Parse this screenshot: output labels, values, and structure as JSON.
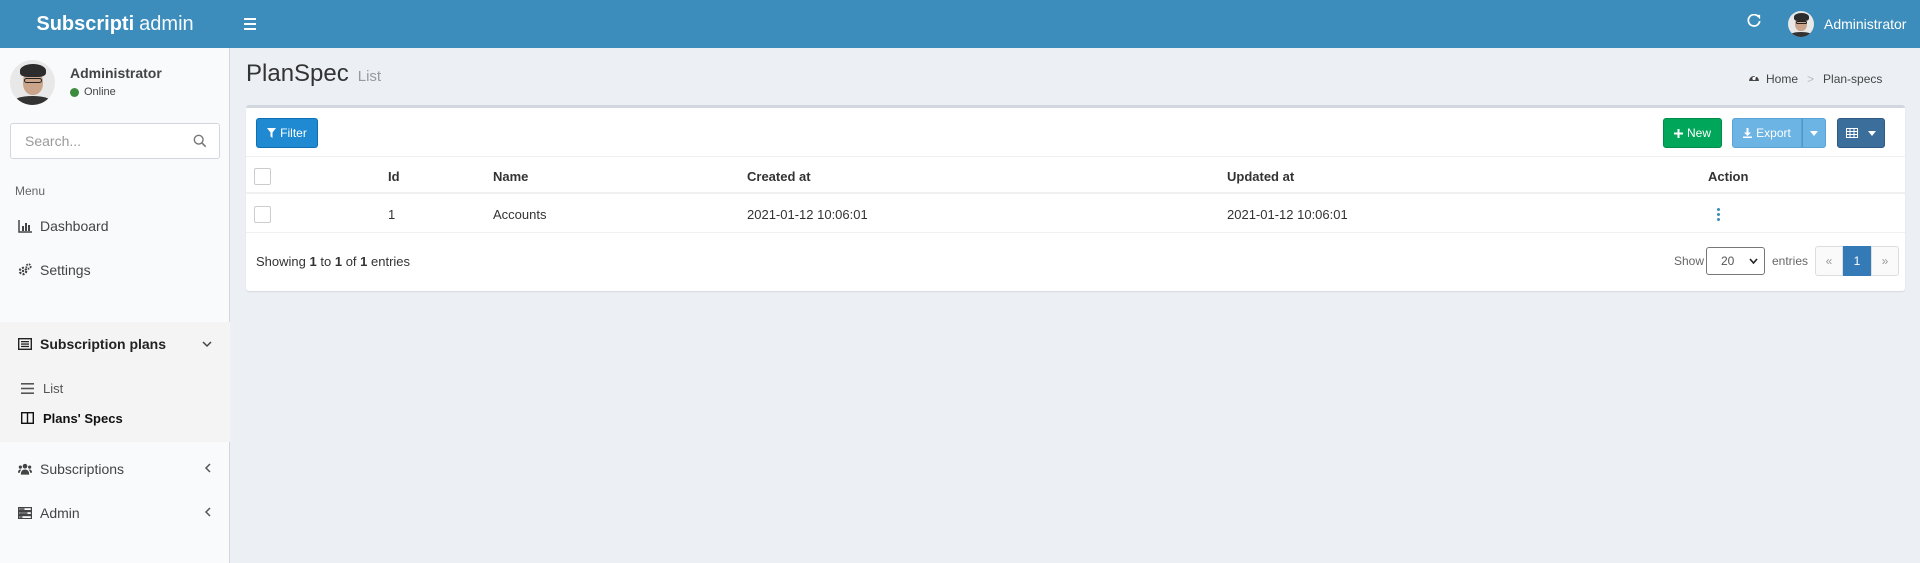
{
  "header": {
    "brand_bold": "Subscripti",
    "brand_light": "admin",
    "user_name": "Administrator",
    "icons": {
      "menu": "hamburger-icon",
      "refresh": "refresh-icon"
    },
    "color": "#3c8dbc"
  },
  "sidebar": {
    "user": {
      "name": "Administrator",
      "status": "Online",
      "status_color": "#3d8b3d"
    },
    "search": {
      "placeholder": "Search..."
    },
    "menu_header": "Menu",
    "items": [
      {
        "label": "Dashboard",
        "icon": "bar-chart-icon"
      },
      {
        "label": "Settings",
        "icon": "gears-icon"
      },
      {
        "label": "Subscription plans",
        "icon": "list-alt-icon",
        "expanded": true,
        "children": [
          {
            "label": "List",
            "icon": "bars-icon"
          },
          {
            "label": "Plans' Specs",
            "icon": "columns-icon",
            "current": true
          }
        ]
      },
      {
        "label": "Subscriptions",
        "icon": "users-icon"
      },
      {
        "label": "Admin",
        "icon": "tasks-icon"
      }
    ]
  },
  "page": {
    "title": "PlanSpec",
    "subtitle": "List",
    "breadcrumb": {
      "home": "Home",
      "current": "Plan-specs"
    }
  },
  "toolbar": {
    "filter_label": "Filter",
    "new_label": "New",
    "export_label": "Export"
  },
  "table": {
    "columns": [
      "Id",
      "Name",
      "Created at",
      "Updated at",
      "Action"
    ],
    "rows": [
      {
        "id": "1",
        "name": "Accounts",
        "created_at": "2021-01-12 10:06:01",
        "updated_at": "2021-01-12 10:06:01"
      }
    ]
  },
  "pagination": {
    "showing_prefix": "Showing",
    "from": "1",
    "to_word": "to",
    "to": "1",
    "of_word": "of",
    "total": "1",
    "entries_word": "entries",
    "show_label": "Show",
    "per_page": "20",
    "entries_label": "entries",
    "prev": "«",
    "current_page": "1",
    "next": "»"
  }
}
